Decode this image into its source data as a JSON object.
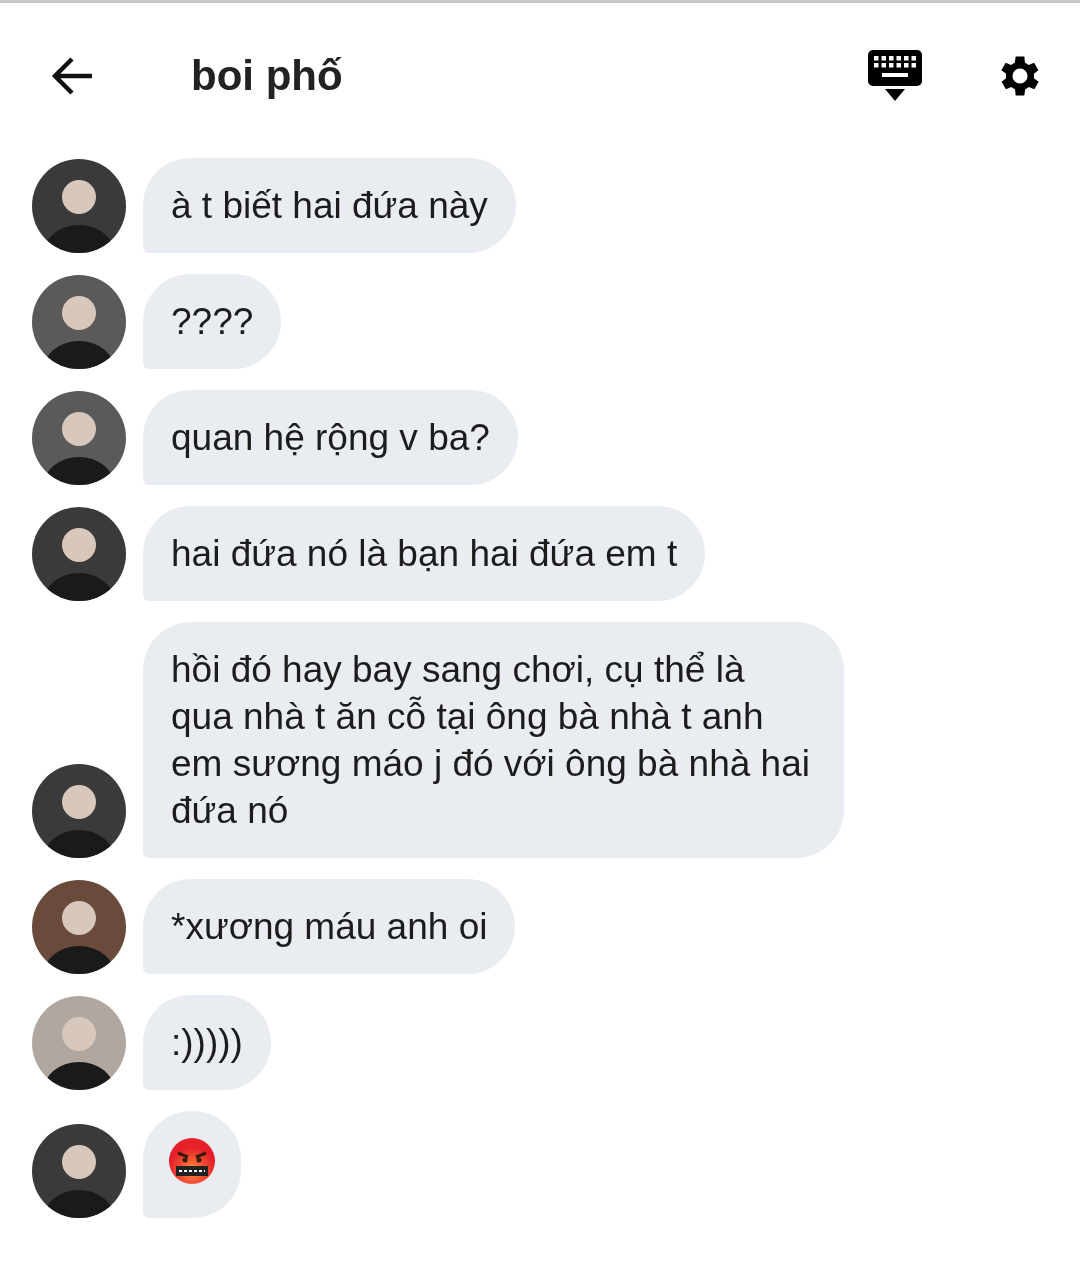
{
  "header": {
    "title": "boi phố"
  },
  "messages": [
    {
      "kind": "text",
      "text": "à t biết hai đứa này"
    },
    {
      "kind": "text",
      "text": "????"
    },
    {
      "kind": "text",
      "text": "quan hệ rộng v ba?"
    },
    {
      "kind": "text",
      "text": "hai đứa nó là bạn hai đứa em t"
    },
    {
      "kind": "text",
      "text": "hồi đó hay bay sang chơi, cụ thể là qua nhà t ăn cỗ tại ông bà nhà t anh em sương máo j đó với ông bà nhà hai đứa nó"
    },
    {
      "kind": "text",
      "text": "*xương máu anh oi"
    },
    {
      "kind": "text",
      "text": ":)))))"
    },
    {
      "kind": "emoji"
    }
  ]
}
